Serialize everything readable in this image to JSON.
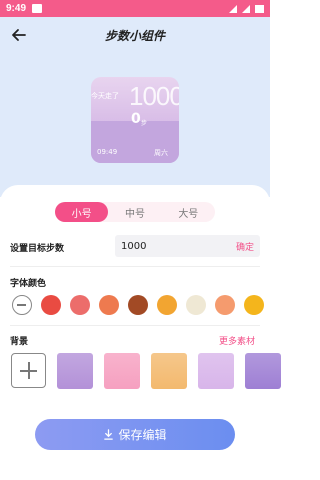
{
  "status": {
    "time": "9:49"
  },
  "header": {
    "title": "步数小组件"
  },
  "widget": {
    "label": "今天走了",
    "big_number": "1000",
    "steps": "0",
    "unit": "步",
    "clock": "09:49",
    "weekday": "周六"
  },
  "tabs": [
    {
      "label": "小号",
      "active": true
    },
    {
      "label": "中号",
      "active": false
    },
    {
      "label": "大号",
      "active": false
    }
  ],
  "goal": {
    "label": "设置目标步数",
    "value": "1000",
    "confirm": "确定"
  },
  "font_color": {
    "label": "字体颜色",
    "colors": [
      "#e94b42",
      "#ec6d6b",
      "#ee7a4f",
      "#a24a25",
      "#f2a531",
      "#efe8d4",
      "#f59b6e",
      "#f4b51c"
    ]
  },
  "background": {
    "label": "背景",
    "more": "更多素材",
    "tiles": [
      "#b391d8",
      "#f6a0c0",
      "#f3b96e",
      "#d8b5ea",
      "#9e7fd4"
    ]
  },
  "save_button": {
    "label": "保存编辑"
  },
  "accent_color": "#f34f88"
}
